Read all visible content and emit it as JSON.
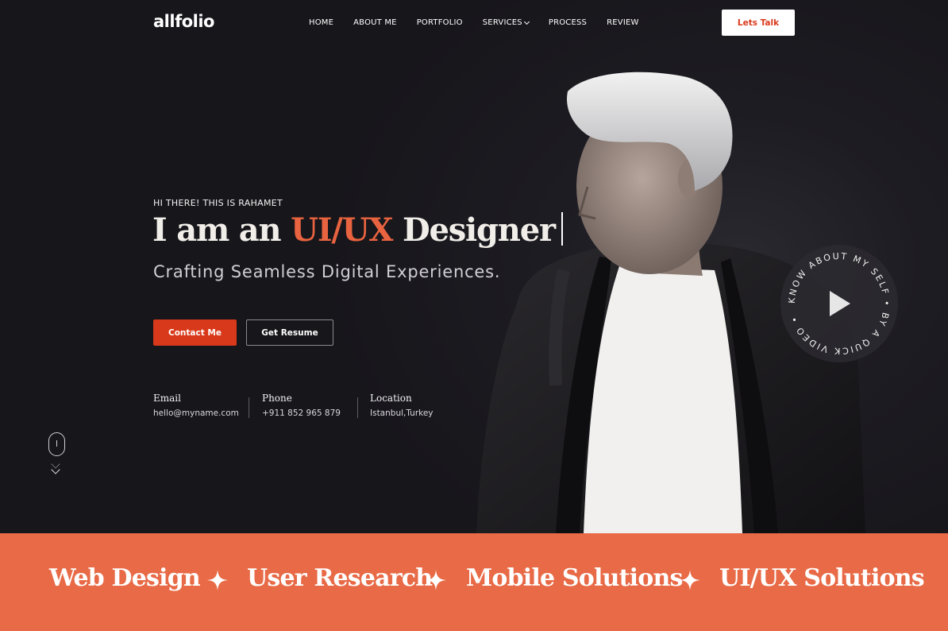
{
  "brand": {
    "name": "allfolio",
    "accent_color": "#e8633f"
  },
  "nav": {
    "items": [
      {
        "label": "HOME"
      },
      {
        "label": "ABOUT ME"
      },
      {
        "label": "PORTFOLIO"
      },
      {
        "label": "SERVICES",
        "has_dropdown": true
      },
      {
        "label": "PROCESS"
      },
      {
        "label": "REVIEW"
      }
    ],
    "cta_label": "Lets Talk"
  },
  "hero": {
    "greeting": "HI THERE! THIS IS RAHAMET",
    "headline_prefix": "I am an ",
    "headline_accent": "UI/UX",
    "headline_suffix": " Designer",
    "subheadline": "Crafting Seamless Digital Experiences.",
    "primary_button": "Contact Me",
    "secondary_button": "Get Resume",
    "contacts": [
      {
        "label": "Email",
        "value": "hello@myname.com"
      },
      {
        "label": "Phone",
        "value": "+911 852 965 879"
      },
      {
        "label": "Location",
        "value": "Istanbul,Turkey"
      }
    ],
    "video_badge_text": "KNOW ABOUT MY SELF • BY A QUICK VIDEO •",
    "scroll_icon": "mouse-scroll-icon",
    "primary_color": "#d9391b"
  },
  "ticker": {
    "background": "#e86a46",
    "items": [
      "Web Design",
      "User Research",
      "Mobile Solutions",
      "UI/UX Solutions"
    ],
    "separator_icon": "four-point-star-icon"
  }
}
